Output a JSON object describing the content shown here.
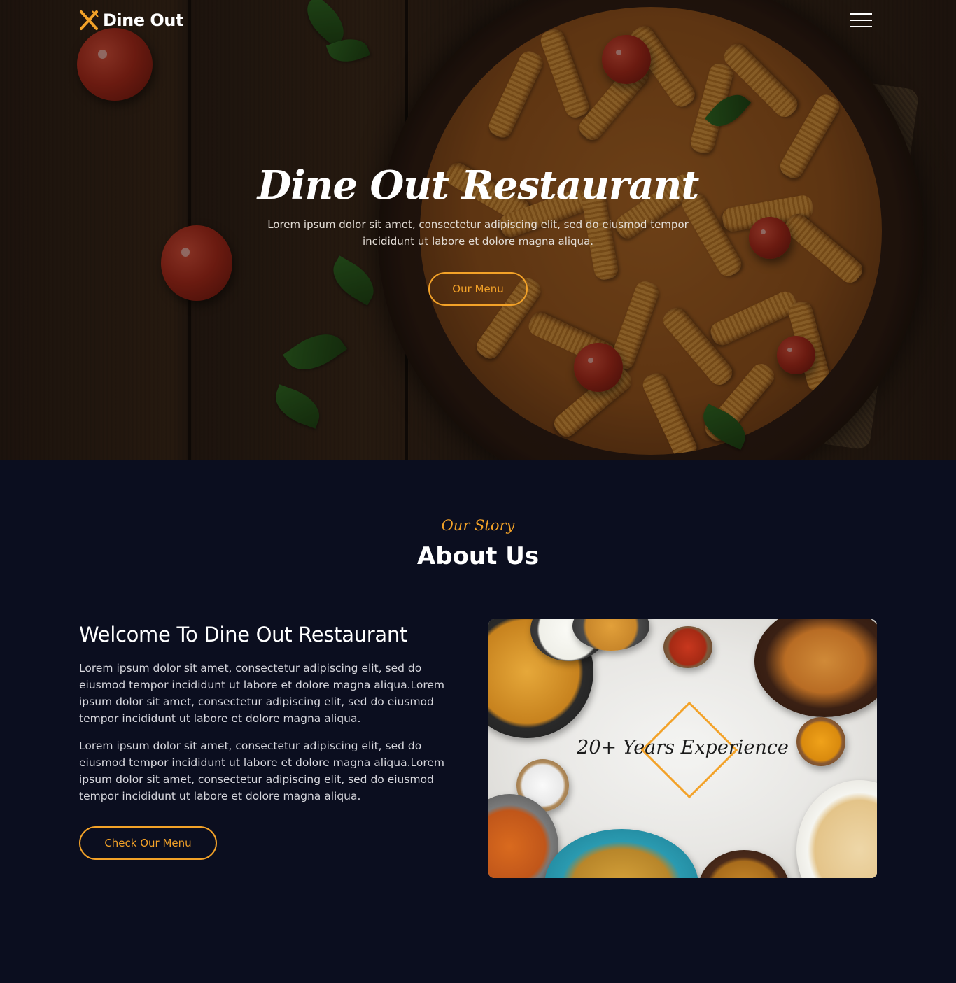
{
  "brand": {
    "name": "Dine Out",
    "accent_color": "#f3a228"
  },
  "nav": {
    "menu_icon": "hamburger-icon"
  },
  "hero": {
    "title": "Dine Out Restaurant",
    "subtitle": "Lorem ipsum dolor sit amet, consectetur adipiscing elit, sed do eiusmod tempor incididunt ut labore et dolore magna aliqua.",
    "button_label": "Our Menu"
  },
  "about": {
    "eyebrow": "Our Story",
    "title": "About Us",
    "heading": "Welcome To Dine Out Restaurant",
    "paragraphs": [
      "Lorem ipsum dolor sit amet, consectetur adipiscing elit, sed do eiusmod tempor incididunt ut labore et dolore magna aliqua.Lorem ipsum dolor sit amet, consectetur adipiscing elit, sed do eiusmod tempor incididunt ut labore et dolore magna aliqua.",
      "Lorem ipsum dolor sit amet, consectetur adipiscing elit, sed do eiusmod tempor incididunt ut labore et dolore magna aliqua.Lorem ipsum dolor sit amet, consectetur adipiscing elit, sed do eiusmod tempor incididunt ut labore et dolore magna aliqua."
    ],
    "button_label": "Check Our Menu",
    "image_caption": "20+ Years Experience"
  }
}
